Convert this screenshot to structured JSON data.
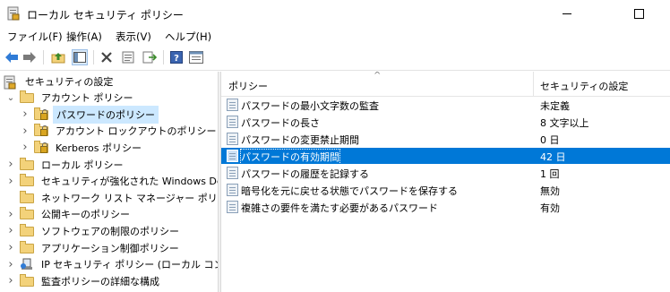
{
  "window": {
    "title": "ローカル セキュリティ ポリシー"
  },
  "menu": [
    "ファイル(F)",
    "操作(A)",
    "表示(V)",
    "ヘルプ(H)"
  ],
  "toolbar": {
    "icons": [
      "back-arrow-icon",
      "forward-arrow-icon",
      "up-folder-icon",
      "show-hide-tree-icon",
      "delete-icon",
      "properties-icon",
      "export-list-icon",
      "help-icon",
      "view-icon"
    ]
  },
  "tree": [
    {
      "label": "セキュリティの設定",
      "level": 0,
      "expander": "",
      "icon": "security-settings-icon"
    },
    {
      "label": "アカウント ポリシー",
      "level": 1,
      "expander": "expanded",
      "icon": "folder-icon"
    },
    {
      "label": "パスワードのポリシー",
      "level": 2,
      "expander": "collapsed",
      "icon": "folder-lock-icon",
      "selected": true
    },
    {
      "label": "アカウント ロックアウトのポリシー",
      "level": 2,
      "expander": "collapsed",
      "icon": "folder-lock-icon"
    },
    {
      "label": "Kerberos ポリシー",
      "level": 2,
      "expander": "collapsed",
      "icon": "folder-lock-icon"
    },
    {
      "label": "ローカル ポリシー",
      "level": 1,
      "expander": "collapsed",
      "icon": "folder-icon"
    },
    {
      "label": "セキュリティが強化された Windows Defer",
      "level": 1,
      "expander": "collapsed",
      "icon": "folder-icon"
    },
    {
      "label": "ネットワーク リスト マネージャー ポリシー",
      "level": 1,
      "expander": "",
      "icon": "folder-icon"
    },
    {
      "label": "公開キーのポリシー",
      "level": 1,
      "expander": "collapsed",
      "icon": "folder-icon"
    },
    {
      "label": "ソフトウェアの制限のポリシー",
      "level": 1,
      "expander": "collapsed",
      "icon": "folder-icon"
    },
    {
      "label": "アプリケーション制御ポリシー",
      "level": 1,
      "expander": "collapsed",
      "icon": "folder-icon"
    },
    {
      "label": "IP セキュリティ ポリシー (ローカル コンピュータ",
      "level": 1,
      "expander": "collapsed",
      "icon": "ip-security-icon"
    },
    {
      "label": "監査ポリシーの詳細な構成",
      "level": 1,
      "expander": "collapsed",
      "icon": "folder-icon"
    }
  ],
  "list": {
    "columns": [
      "ポリシー",
      "セキュリティの設定"
    ],
    "rows": [
      {
        "policy": "パスワードの最小文字数の監査",
        "setting": "未定義"
      },
      {
        "policy": "パスワードの長さ",
        "setting": "8 文字以上"
      },
      {
        "policy": "パスワードの変更禁止期間",
        "setting": "0 日"
      },
      {
        "policy": "パスワードの有効期間",
        "setting": "42 日",
        "selected": true
      },
      {
        "policy": "パスワードの履歴を記録する",
        "setting": "1 回"
      },
      {
        "policy": "暗号化を元に戻せる状態でパスワードを保存する",
        "setting": "無効"
      },
      {
        "policy": "複雑さの要件を満たす必要があるパスワード",
        "setting": "有効"
      }
    ]
  }
}
